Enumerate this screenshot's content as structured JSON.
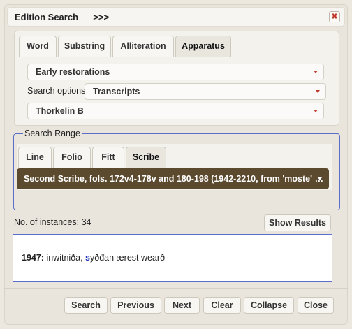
{
  "dialog": {
    "title": "Edition Search",
    "expand_label": ">>>",
    "close_label": "✖"
  },
  "top_tabs": [
    "Word",
    "Substring",
    "Alliteration",
    "Apparatus"
  ],
  "active_top_tab": "Apparatus",
  "apparatus": {
    "restorations_select": "Early restorations",
    "search_options_label": "Search options:",
    "search_options_select": "Transcripts",
    "transcript_select": "Thorkelin B"
  },
  "search_range": {
    "legend": "Search Range",
    "tabs": [
      "Line",
      "Folio",
      "Fitt",
      "Scribe"
    ],
    "active_tab": "Scribe",
    "scribe_select": "Second Scribe, fols. 172v4-178v and 180-198 (1942-2210, from 'moste' …"
  },
  "instances": {
    "label": "No. of instances: 34",
    "show_results_label": "Show Results"
  },
  "result": {
    "line_number": "1947:",
    "text_before": " inwitniða,",
    "highlight": " s",
    "text_after": "yðđan ærest wearð"
  },
  "footer_buttons": {
    "search": "Search",
    "previous": "Previous",
    "next": "Next",
    "clear": "Clear",
    "collapse": "Collapse",
    "close": "Close"
  },
  "colors": {
    "accent_red": "#c0392b",
    "scribe_bg": "#5c4a2f",
    "range_border": "#5b6fc9",
    "highlight": "#1a2fb8"
  }
}
